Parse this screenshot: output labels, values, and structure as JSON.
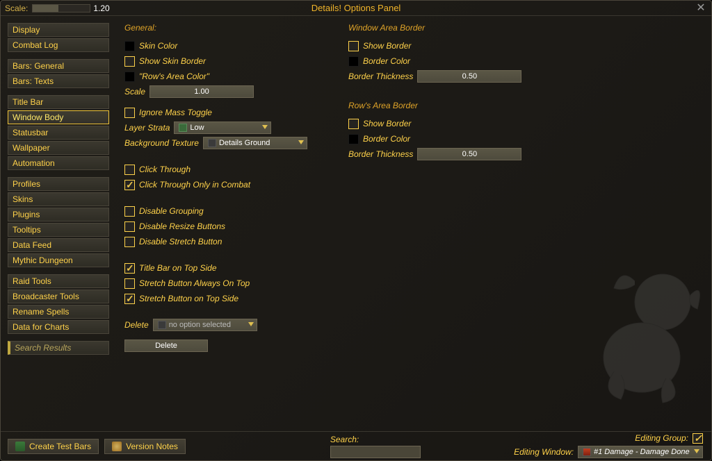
{
  "titlebar": {
    "scale_label": "Scale:",
    "scale_value": "1.20",
    "window_title": "Details! Options Panel"
  },
  "sidebar": {
    "groups": [
      [
        "Display",
        "Combat Log"
      ],
      [
        "Bars: General",
        "Bars: Texts"
      ],
      [
        "Title Bar",
        "Window Body",
        "Statusbar",
        "Wallpaper",
        "Automation"
      ],
      [
        "Profiles",
        "Skins",
        "Plugins",
        "Tooltips",
        "Data Feed",
        "Mythic Dungeon"
      ],
      [
        "Raid Tools",
        "Broadcaster Tools",
        "Rename Spells",
        "Data for Charts"
      ]
    ],
    "active": "Window Body",
    "search_label": "Search Results"
  },
  "general": {
    "title": "General:",
    "skin_color_label": "Skin Color",
    "show_skin_border_label": "Show Skin Border",
    "rows_area_color_label": "\"Row's Area Color\"",
    "scale_label": "Scale",
    "scale_value": "1.00",
    "ignore_mass_toggle_label": "Ignore Mass Toggle",
    "ignore_mass_toggle_checked": false,
    "layer_strata_label": "Layer Strata",
    "layer_strata_value": "Low",
    "bg_texture_label": "Background Texture",
    "bg_texture_value": "Details Ground",
    "click_through_label": "Click Through",
    "click_through_checked": false,
    "click_through_combat_label": "Click Through Only in Combat",
    "click_through_combat_checked": true,
    "disable_grouping_label": "Disable Grouping",
    "disable_resize_label": "Disable Resize Buttons",
    "disable_stretch_label": "Disable Stretch Button",
    "title_bar_on_top_label": "Title Bar on Top Side",
    "title_bar_on_top_checked": true,
    "stretch_always_top_label": "Stretch Button Always On Top",
    "stretch_always_top_checked": false,
    "stretch_on_top_side_label": "Stretch Button on Top Side",
    "stretch_on_top_side_checked": true,
    "delete_label": "Delete",
    "delete_dropdown_value": "no option selected",
    "delete_button": "Delete"
  },
  "window_area": {
    "title": "Window Area Border",
    "show_border_label": "Show Border",
    "show_border_checked": false,
    "border_color_label": "Border Color",
    "thickness_label": "Border Thickness",
    "thickness_value": "0.50"
  },
  "rows_area": {
    "title": "Row's Area Border",
    "show_border_label": "Show Border",
    "show_border_checked": false,
    "border_color_label": "Border Color",
    "thickness_label": "Border Thickness",
    "thickness_value": "0.50"
  },
  "footer": {
    "create_test_bars": "Create Test Bars",
    "version_notes": "Version Notes",
    "search_label": "Search:",
    "editing_group_label": "Editing Group:",
    "editing_group_checked": true,
    "editing_window_label": "Editing Window:",
    "editing_window_value": "#1 Damage - Damage Done"
  }
}
